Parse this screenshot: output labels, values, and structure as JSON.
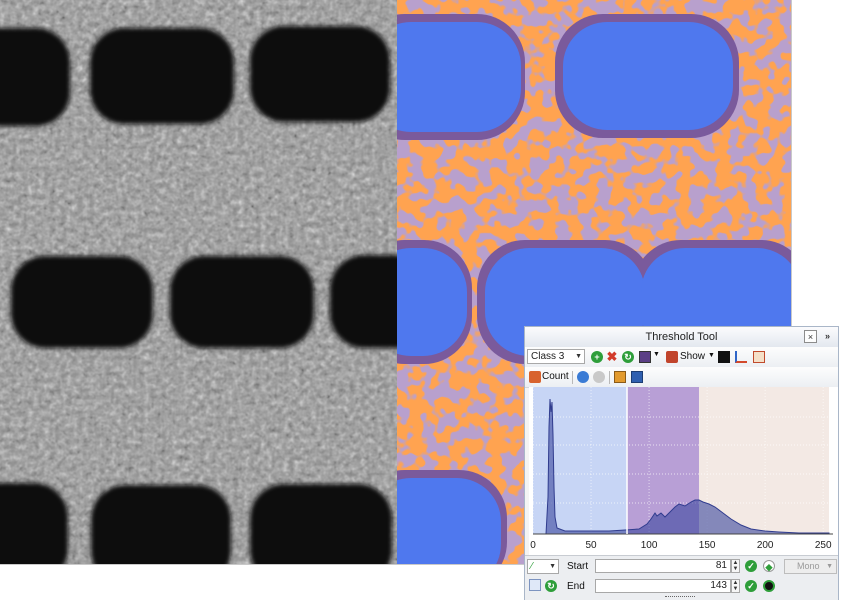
{
  "images": {
    "source_image_label": "grayscale micrograph",
    "classified_image_label": "classified threshold overlay",
    "class_colors": {
      "background_holes": "#4f78ee",
      "class_orange": "#ffa350",
      "class_purple": "#7a5a9c"
    }
  },
  "threshold_tool": {
    "title": "Threshold Tool",
    "close_icon": "×",
    "collapse_icon": "»",
    "class_select": "Class 3",
    "show_label": "Show",
    "count_label": "Count",
    "start_label": "Start",
    "end_label": "End",
    "start_value": "81",
    "end_value": "143",
    "mono_label": "Mono",
    "histogram": {
      "x_ticks": [
        "0",
        "50",
        "100",
        "150",
        "200",
        "250"
      ],
      "x_range": [
        0,
        255
      ],
      "regions": [
        {
          "name": "class-1",
          "from": 0,
          "to": 81,
          "color": "#c7d5f5"
        },
        {
          "name": "class-3",
          "from": 81,
          "to": 143,
          "color": "#b89fd6"
        },
        {
          "name": "class-2",
          "from": 143,
          "to": 255,
          "color": "#f3e9e4"
        }
      ],
      "grid": true
    }
  }
}
